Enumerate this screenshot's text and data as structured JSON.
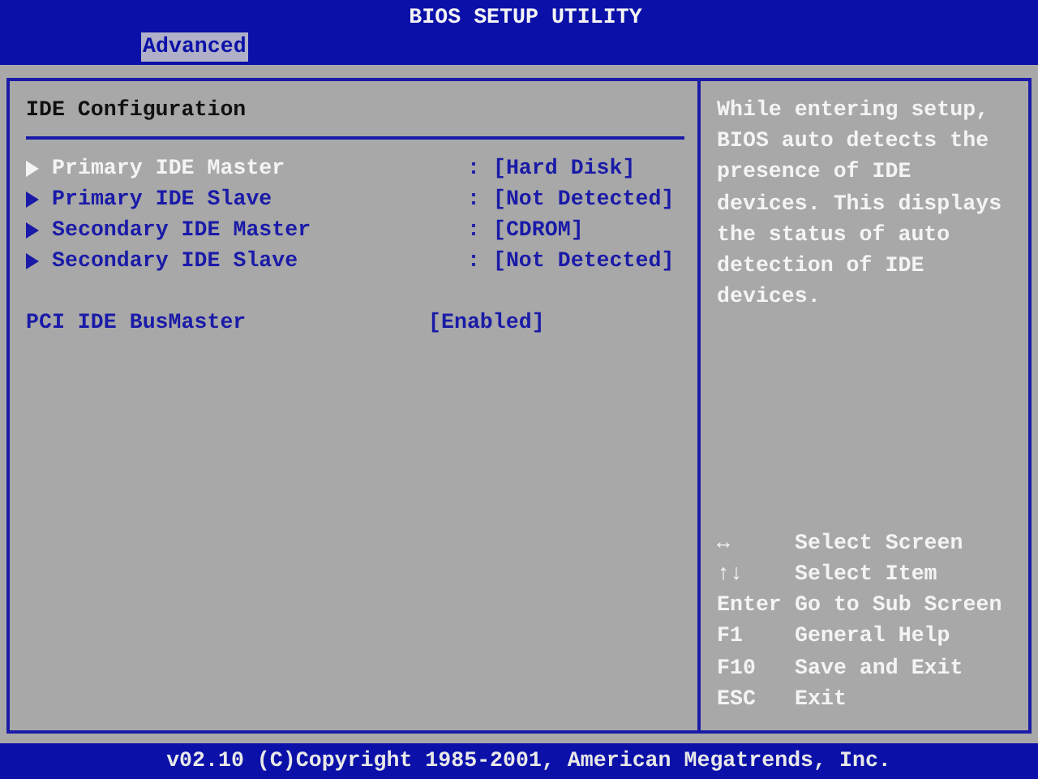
{
  "header": {
    "title": "BIOS SETUP UTILITY",
    "tabs": [
      {
        "label": "Advanced",
        "selected": true
      }
    ]
  },
  "panel": {
    "title": "IDE Configuration",
    "items": [
      {
        "kind": "submenu",
        "label": "Primary IDE Master",
        "value": ": [Hard Disk]",
        "selected": true
      },
      {
        "kind": "submenu",
        "label": "Primary IDE Slave",
        "value": ": [Not Detected]",
        "selected": false
      },
      {
        "kind": "submenu",
        "label": "Secondary IDE Master",
        "value": ": [CDROM]",
        "selected": false
      },
      {
        "kind": "submenu",
        "label": "Secondary IDE Slave",
        "value": ": [Not Detected]",
        "selected": false
      },
      {
        "kind": "setting",
        "label": "PCI IDE BusMaster",
        "value": "[Enabled]",
        "selected": false
      }
    ]
  },
  "help": {
    "text": "While entering setup, BIOS auto detects the presence of IDE devices. This displays the status of auto detection of IDE devices.",
    "keys": [
      {
        "key": "↔",
        "action": "Select Screen"
      },
      {
        "key": "↑↓",
        "action": "Select Item"
      },
      {
        "key": "Enter",
        "action": "Go to Sub Screen"
      },
      {
        "key": "F1",
        "action": "General Help"
      },
      {
        "key": "F10",
        "action": "Save and Exit"
      },
      {
        "key": "ESC",
        "action": "Exit"
      }
    ]
  },
  "footer": "v02.10 (C)Copyright 1985-2001, American Megatrends, Inc."
}
